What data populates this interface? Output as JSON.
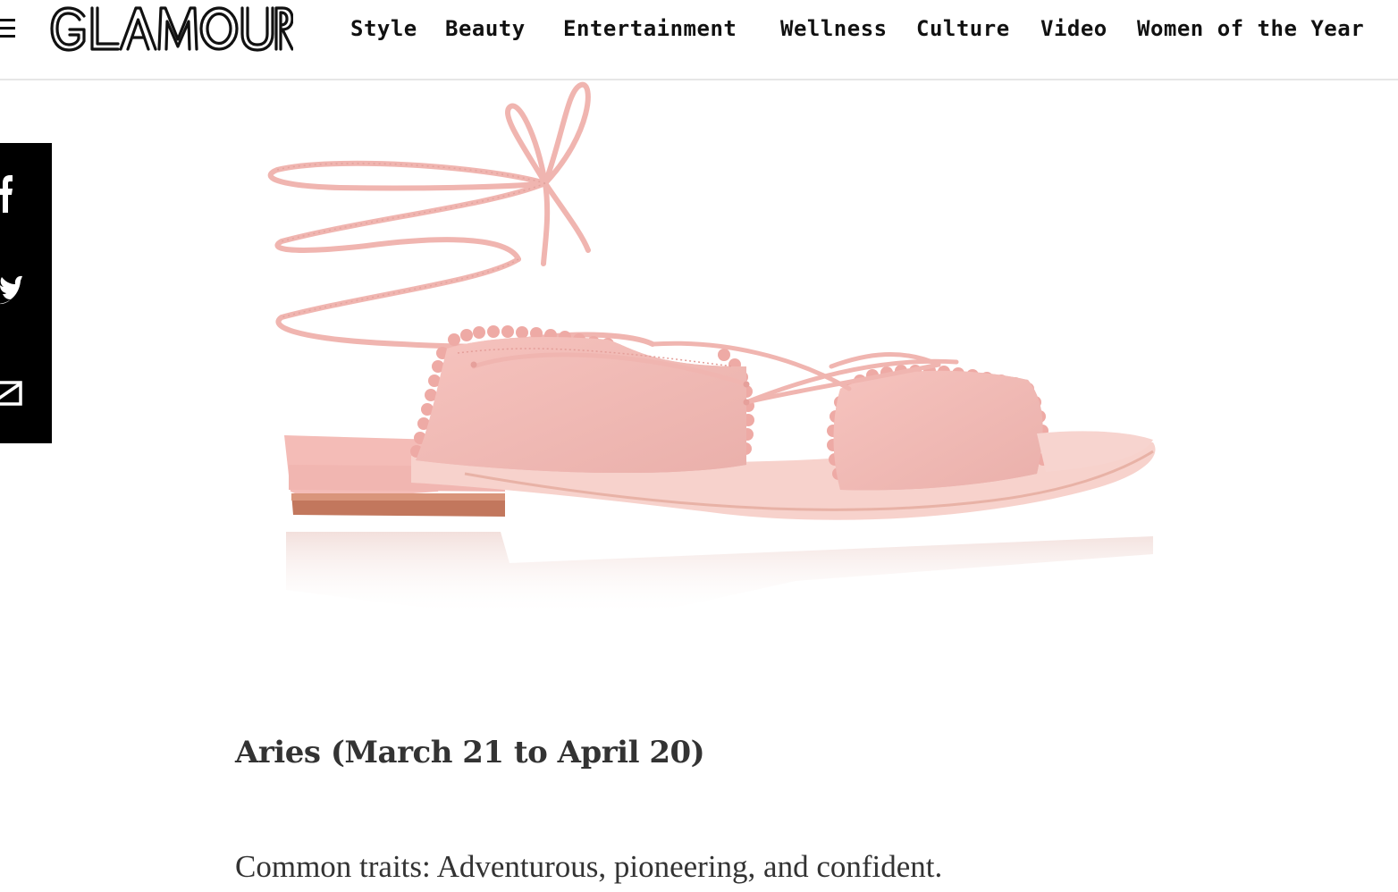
{
  "header": {
    "logo_text": "GLAMOUR",
    "nav": [
      {
        "label": "Style"
      },
      {
        "label": "Beauty"
      },
      {
        "label": "Entertainment"
      },
      {
        "label": "Wellness"
      },
      {
        "label": "Culture"
      },
      {
        "label": "Video"
      },
      {
        "label": "Women of the Year"
      }
    ]
  },
  "share": {
    "items": [
      {
        "icon": "facebook-icon"
      },
      {
        "icon": "twitter-icon"
      },
      {
        "icon": "email-icon"
      }
    ]
  },
  "article": {
    "product_image": {
      "color": "#f2b9b4"
    },
    "heading": "Aries (March 21 to April 20)",
    "paragraph": "Common traits: Adventurous, pioneering, and confident."
  },
  "colors": {
    "text": "#333333",
    "header_border": "#e6e6e6",
    "share_rail": "#000000",
    "sandal_pink": "#f2b9b4"
  }
}
